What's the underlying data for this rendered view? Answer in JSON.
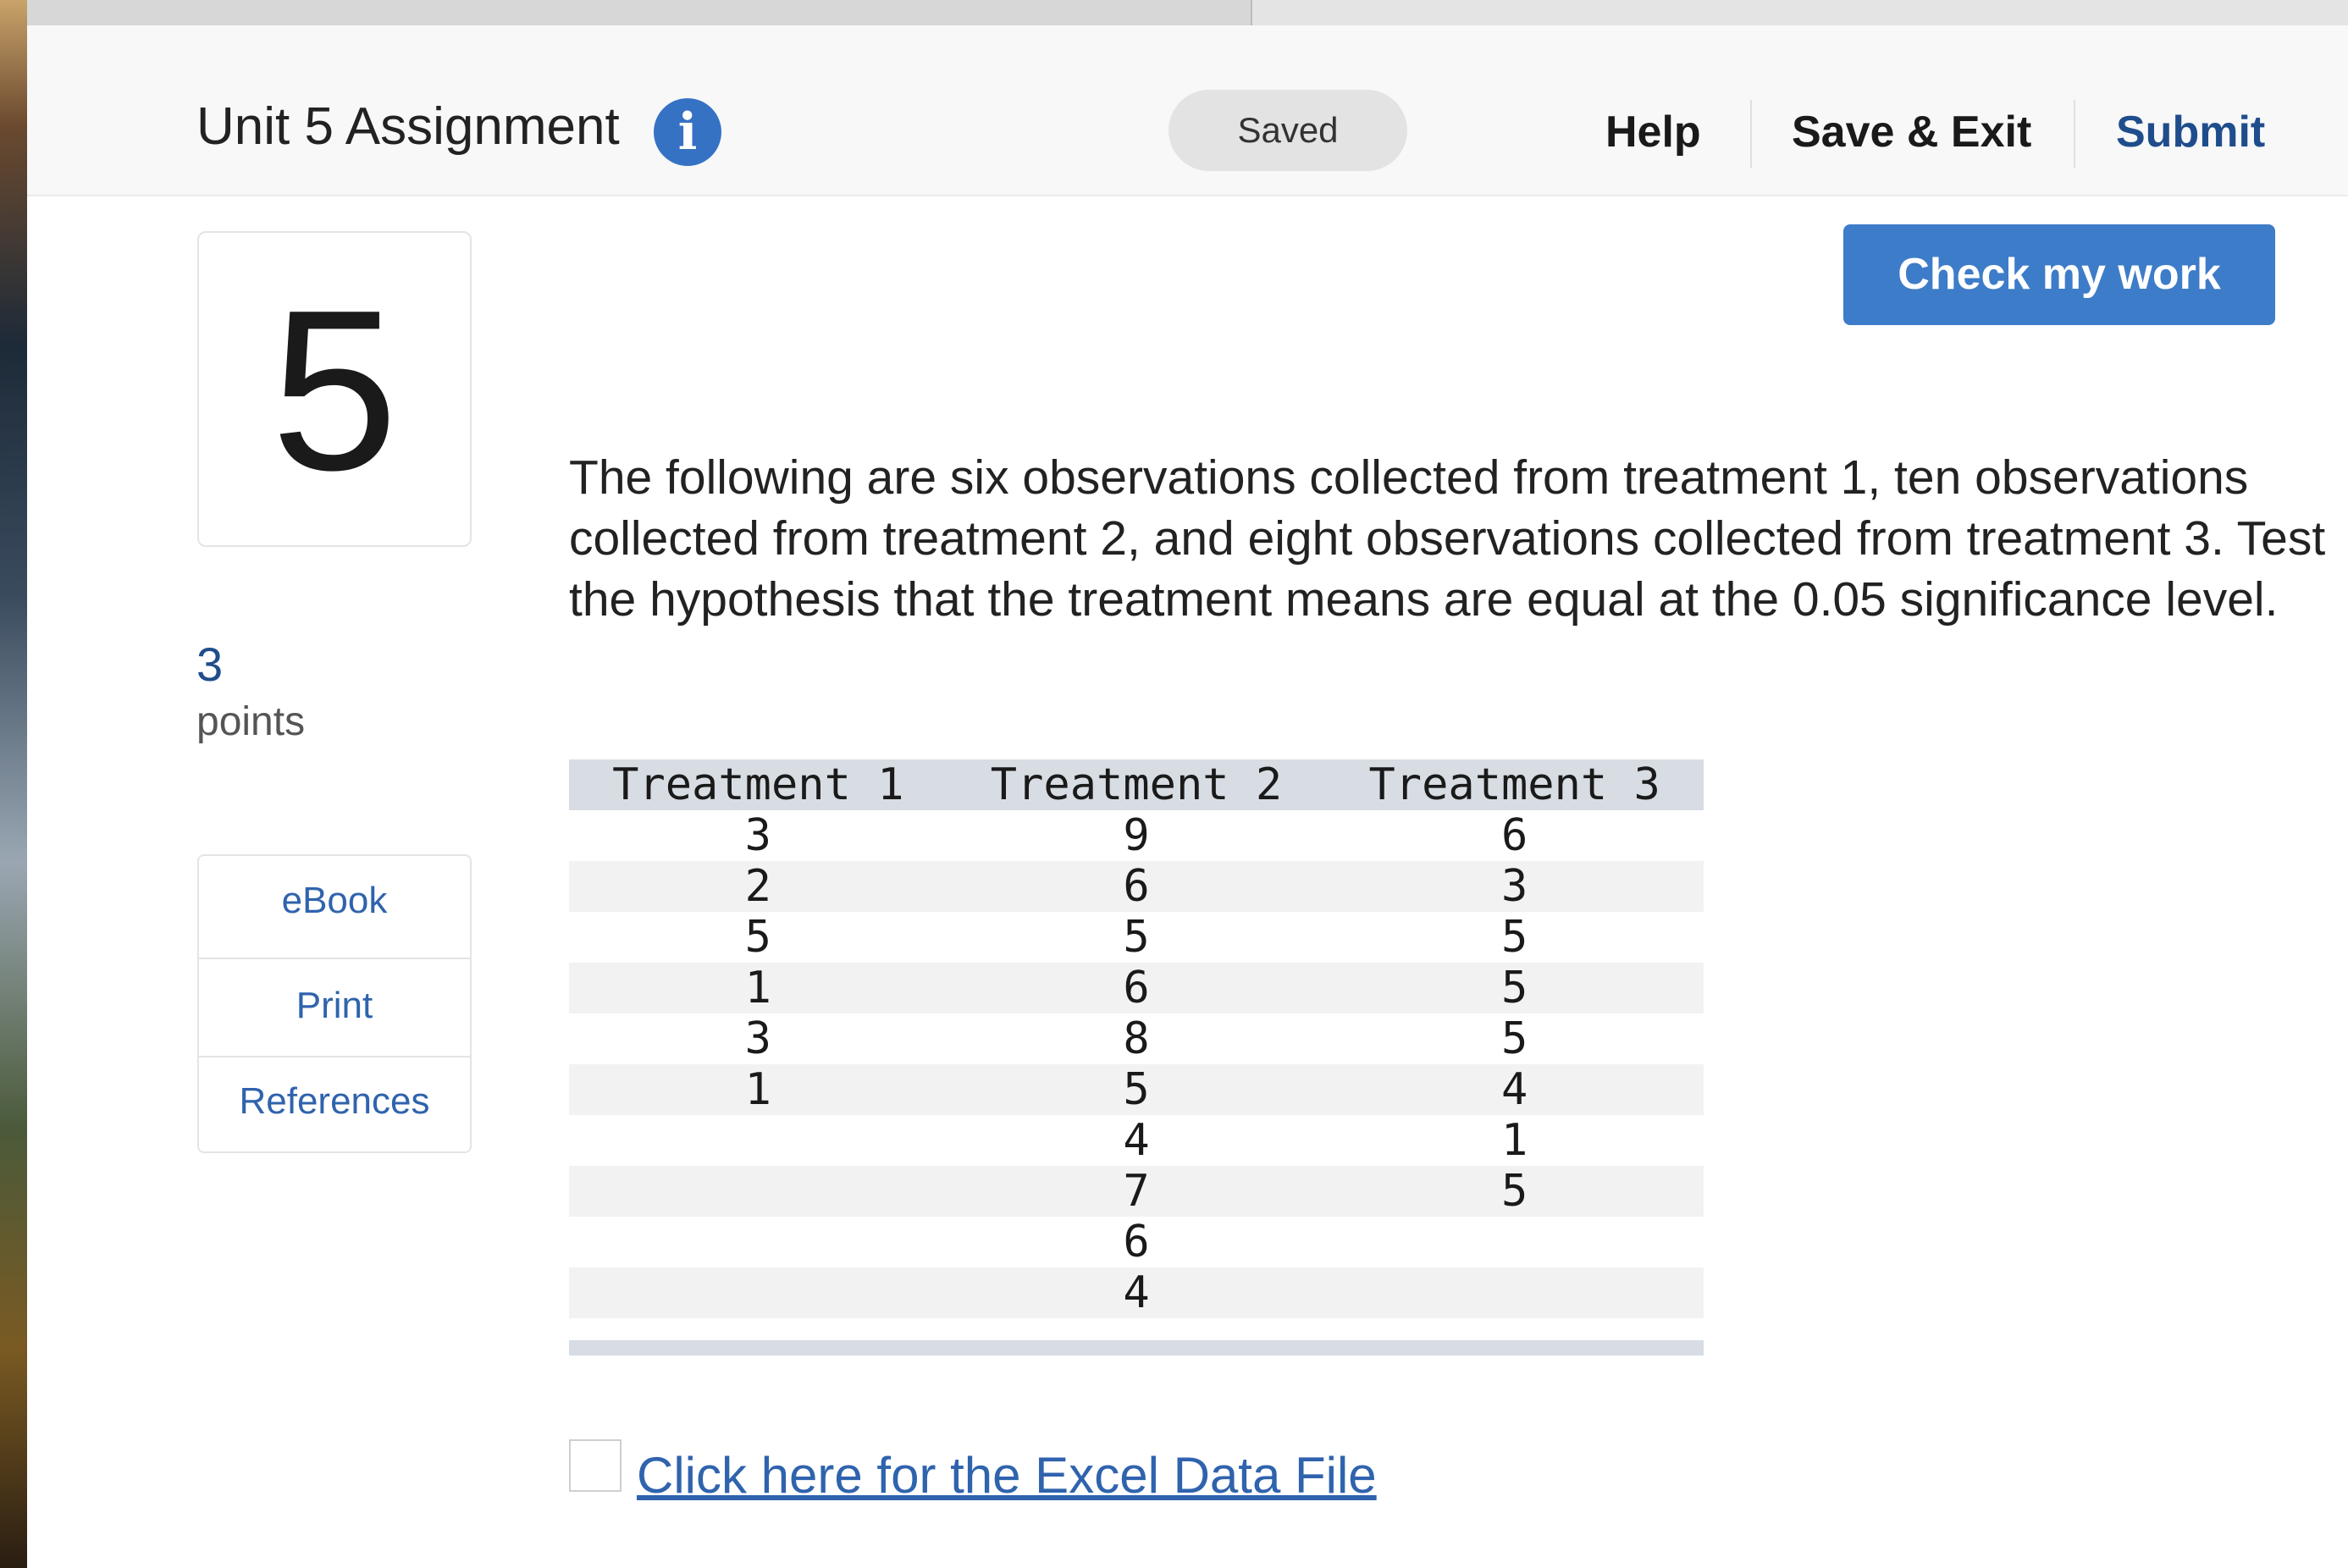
{
  "header": {
    "title": "Unit 5 Assignment",
    "saved_status": "Saved",
    "help_label": "Help",
    "save_exit_label": "Save & Exit",
    "submit_label": "Submit"
  },
  "actions": {
    "check_work_label": "Check my work"
  },
  "question": {
    "number": "5",
    "points_value": "3",
    "points_label": "points",
    "text": "The following are six observations collected from treatment 1, ten observations collected from treatment 2, and eight observations collected from treatment 3. Test the hypothesis that the treatment means are equal at the 0.05 significance level."
  },
  "resources": {
    "ebook": "eBook",
    "print": "Print",
    "references": "References"
  },
  "table": {
    "headers": [
      "Treatment 1",
      "Treatment 2",
      "Treatment 3"
    ],
    "rows": [
      [
        "3",
        "9",
        "6"
      ],
      [
        "2",
        "6",
        "3"
      ],
      [
        "5",
        "5",
        "5"
      ],
      [
        "1",
        "6",
        "5"
      ],
      [
        "3",
        "8",
        "5"
      ],
      [
        "1",
        "5",
        "4"
      ],
      [
        "",
        "4",
        "1"
      ],
      [
        "",
        "7",
        "5"
      ],
      [
        "",
        "6",
        ""
      ],
      [
        "",
        "4",
        ""
      ]
    ]
  },
  "excel_link": "Click here for the Excel Data File",
  "colors": {
    "accent_blue": "#3d7cc8",
    "link_blue": "#2f63ad",
    "submit_blue": "#1f4d8c",
    "table_header": "#d7dde3"
  },
  "icons": {
    "info": "info-icon"
  }
}
